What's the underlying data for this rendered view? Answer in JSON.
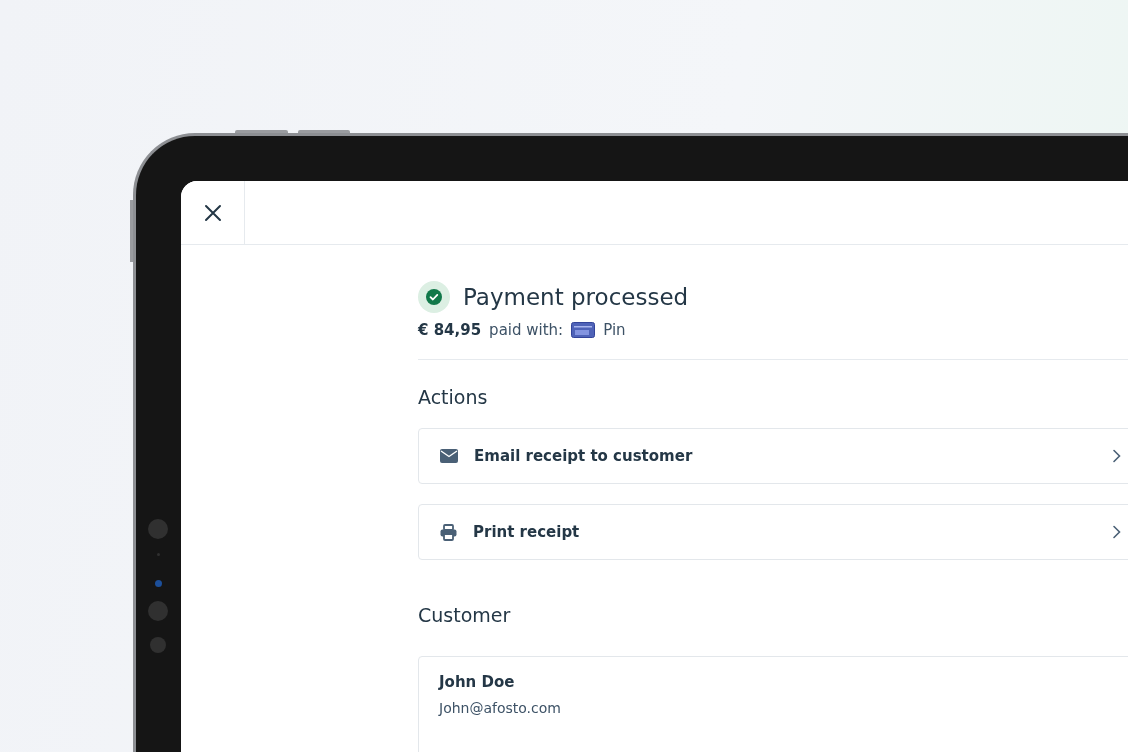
{
  "status": {
    "success": true,
    "title": "Payment processed",
    "amount": "€ 84,95",
    "paid_with_label": "paid with:",
    "method": "Pin"
  },
  "actions": {
    "heading": "Actions",
    "items": [
      {
        "kind": "email",
        "label": "Email receipt to customer"
      },
      {
        "kind": "print",
        "label": "Print receipt"
      }
    ]
  },
  "customer": {
    "heading": "Customer",
    "name": "John Doe",
    "email": "John@afosto.com"
  }
}
